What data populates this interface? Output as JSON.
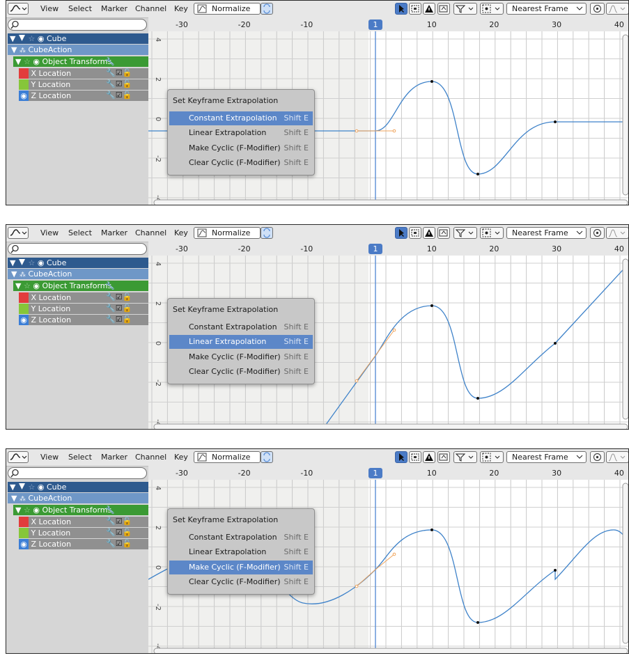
{
  "header": {
    "menus": [
      "View",
      "Select",
      "Marker",
      "Channel",
      "Key"
    ],
    "normalize_label": "Normalize",
    "snap_value": "Nearest Frame"
  },
  "ruler": {
    "ticks": [
      "-30",
      "-20",
      "-10",
      "1",
      "10",
      "20",
      "30",
      "40"
    ],
    "current_frame": "1",
    "y_ticks": [
      "4",
      "2",
      "0",
      "-2",
      "-4"
    ]
  },
  "channels": {
    "object": "Cube",
    "action": "CubeAction",
    "group": "Object Transforms",
    "x": "X Location",
    "y": "Y Location",
    "z": "Z Location"
  },
  "menu": {
    "title": "Set Keyframe Extrapolation",
    "items": [
      {
        "label": "Constant Extrapolation",
        "shortcut": "Shift E"
      },
      {
        "label": "Linear Extrapolation",
        "shortcut": "Shift E"
      },
      {
        "label": "Make Cyclic (F-Modifier)",
        "shortcut": "Shift E"
      },
      {
        "label": "Clear Cyclic (F-Modifier)",
        "shortcut": "Shift E"
      }
    ]
  },
  "panels": [
    {
      "highlighted_item": "Constant Extrapolation",
      "mode": "constant"
    },
    {
      "highlighted_item": "Linear Extrapolation",
      "mode": "linear"
    },
    {
      "highlighted_item": "Make Cyclic (F-Modifier)",
      "mode": "cyclic"
    }
  ],
  "colors": {
    "accent": "#5c87c8",
    "curve": "#3e82c9",
    "object_row": "#2e5a8e",
    "action_row": "#6f97c7",
    "group_row": "#3b9a34",
    "channel_row": "#909090",
    "x_swatch": "#e23c3c",
    "y_swatch": "#86c63a",
    "z_swatch": "#3b7ed6"
  }
}
